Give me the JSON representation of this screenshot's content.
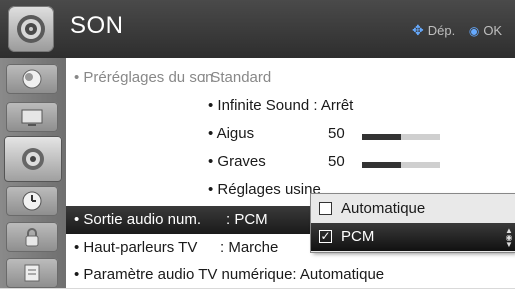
{
  "header": {
    "title": "SON",
    "hint_move": "Dép.",
    "hint_ok": "OK",
    "icon": "speaker-icon"
  },
  "sidebar": {
    "items": [
      {
        "icon": "picture-icon"
      },
      {
        "icon": "screen-icon"
      },
      {
        "icon": "speaker-icon",
        "active": true
      },
      {
        "icon": "clock-icon"
      },
      {
        "icon": "lock-icon"
      },
      {
        "icon": "options-icon"
      }
    ]
  },
  "menu": {
    "presets_label": "• Préréglages du son",
    "presets_value": ": Standard",
    "infinite_label": "• Infinite Sound : Arrêt",
    "aigus_label": "• Aigus",
    "aigus_value": "50",
    "aigus_level": 0.5,
    "graves_label": "• Graves",
    "graves_value": "50",
    "graves_level": 0.5,
    "reset_label": "• Réglages usine",
    "digital_out_label": "• Sortie audio num.",
    "digital_out_value": ": PCM",
    "speakers_label": "• Haut-parleurs TV",
    "speakers_value": ": Marche",
    "tv_audio_label": "• Paramètre audio TV numérique: Automatique"
  },
  "popup": {
    "options": [
      {
        "label": "Automatique",
        "checked": false
      },
      {
        "label": "PCM",
        "checked": true
      }
    ]
  },
  "colors": {
    "highlight": "#1a1a1a",
    "hint_accent": "#66aaff"
  }
}
